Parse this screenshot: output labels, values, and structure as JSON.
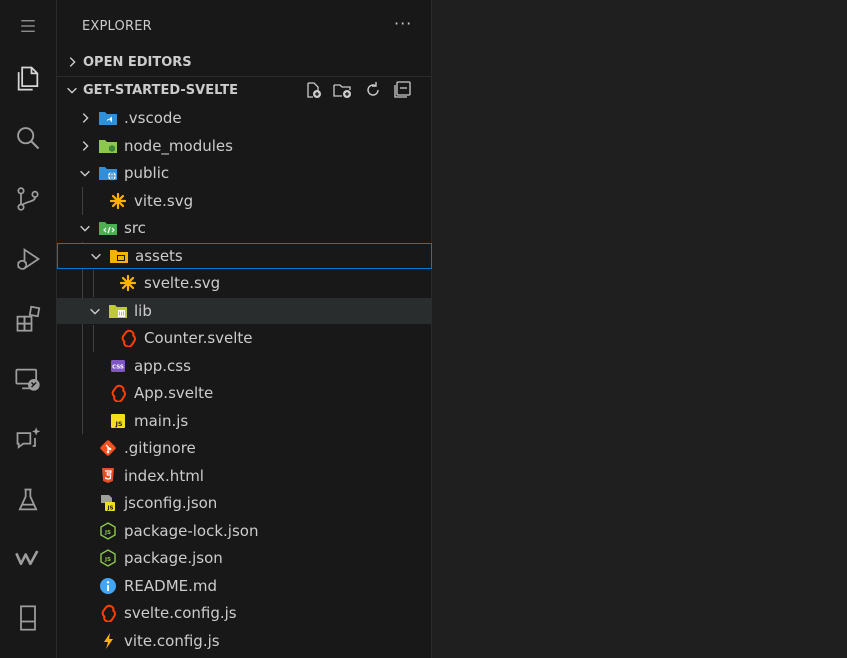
{
  "activity_bar": {
    "items": [
      {
        "name": "menu-icon"
      },
      {
        "name": "explorer-icon"
      },
      {
        "name": "search-icon"
      },
      {
        "name": "source-control-icon"
      },
      {
        "name": "run-debug-icon"
      },
      {
        "name": "extensions-icon"
      },
      {
        "name": "remote-explorer-icon"
      },
      {
        "name": "chat-icon"
      },
      {
        "name": "testing-icon"
      },
      {
        "name": "wakatime-icon"
      },
      {
        "name": "panel-icon"
      }
    ]
  },
  "sidebar": {
    "title": "EXPLORER",
    "more": "···",
    "open_editors": "OPEN EDITORS",
    "project": "GET-STARTED-SVELTE",
    "tree": [
      {
        "label": ".vscode",
        "icon": "vscode-folder-icon",
        "depth": 0,
        "twisty": "closed"
      },
      {
        "label": "node_modules",
        "icon": "node-folder-icon",
        "depth": 0,
        "twisty": "closed"
      },
      {
        "label": "public",
        "icon": "public-folder-icon",
        "depth": 0,
        "twisty": "open"
      },
      {
        "label": "vite.svg",
        "icon": "svg-file-icon",
        "depth": 1,
        "twisty": "none"
      },
      {
        "label": "src",
        "icon": "src-folder-icon",
        "depth": 0,
        "twisty": "open"
      },
      {
        "label": "assets",
        "icon": "assets-folder-icon",
        "depth": 1,
        "twisty": "open"
      },
      {
        "label": "svelte.svg",
        "icon": "svg-file-icon",
        "depth": 2,
        "twisty": "none"
      },
      {
        "label": "lib",
        "icon": "lib-folder-icon",
        "depth": 1,
        "twisty": "open"
      },
      {
        "label": "Counter.svelte",
        "icon": "svelte-file-icon",
        "depth": 2,
        "twisty": "none"
      },
      {
        "label": "app.css",
        "icon": "css-file-icon",
        "depth": 1,
        "twisty": "none"
      },
      {
        "label": "App.svelte",
        "icon": "svelte-file-icon",
        "depth": 1,
        "twisty": "none"
      },
      {
        "label": "main.js",
        "icon": "js-file-icon",
        "depth": 1,
        "twisty": "none"
      },
      {
        "label": ".gitignore",
        "icon": "git-file-icon",
        "depth": 0,
        "twisty": "none"
      },
      {
        "label": "index.html",
        "icon": "html-file-icon",
        "depth": 0,
        "twisty": "none"
      },
      {
        "label": "jsconfig.json",
        "icon": "jsconfig-file-icon",
        "depth": 0,
        "twisty": "none"
      },
      {
        "label": "package-lock.json",
        "icon": "node-json-file-icon",
        "depth": 0,
        "twisty": "none"
      },
      {
        "label": "package.json",
        "icon": "node-json-file-icon",
        "depth": 0,
        "twisty": "none"
      },
      {
        "label": "README.md",
        "icon": "info-file-icon",
        "depth": 0,
        "twisty": "none"
      },
      {
        "label": "svelte.config.js",
        "icon": "svelte-file-icon",
        "depth": 0,
        "twisty": "none"
      },
      {
        "label": "vite.config.js",
        "icon": "vite-file-icon",
        "depth": 0,
        "twisty": "none"
      }
    ]
  },
  "colors": {
    "selection_border": "#0078d4",
    "accent_svelte": "#ff3e00",
    "accent_js": "#f5de19",
    "accent_node": "#8cc84b"
  }
}
